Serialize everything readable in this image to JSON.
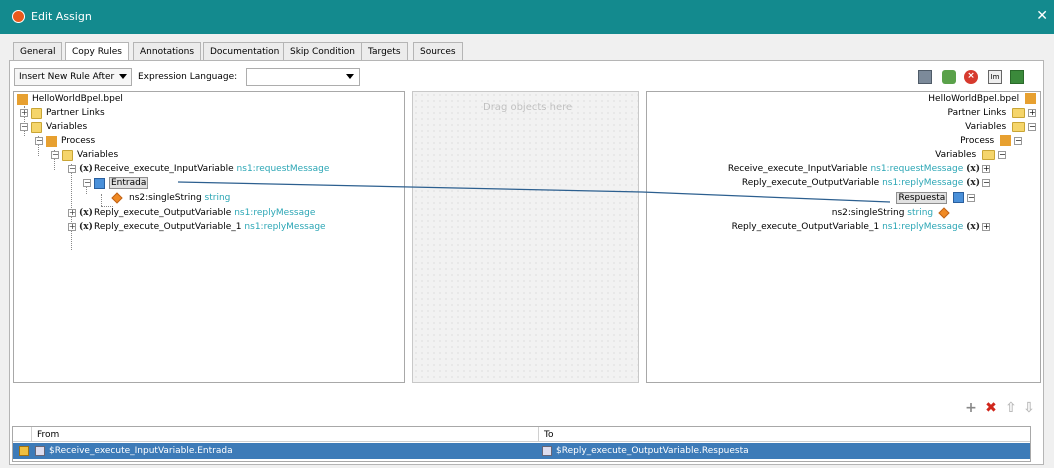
{
  "window": {
    "title": "Edit Assign",
    "close_glyph": "✕"
  },
  "tabs": [
    {
      "label": "General"
    },
    {
      "label": "Copy Rules",
      "active": true
    },
    {
      "label": "Annotations"
    },
    {
      "label": "Documentation"
    },
    {
      "label": "Skip Condition"
    },
    {
      "label": "Targets"
    },
    {
      "label": "Sources"
    }
  ],
  "toolbar": {
    "insert_rule_label": "Insert New Rule After",
    "expression_language_label": "Expression Language:",
    "expression_language_value": "",
    "icons": [
      "function-icon",
      "xpath-icon",
      "delete-icon",
      "literal-icon",
      "append-icon"
    ]
  },
  "center": {
    "placeholder": "Drag objects here"
  },
  "source_tree": {
    "root": "HelloWorldBpel.bpel",
    "partner_links": "Partner Links",
    "variables": "Variables",
    "process": "Process",
    "process_variables": "Variables",
    "receive_var": "Receive_execute_InputVariable",
    "receive_type": "ns1:requestMessage",
    "part": "Entrada",
    "part_child": "ns2:singleString",
    "part_child_type": "string",
    "reply_var": "Reply_execute_OutputVariable",
    "reply_type": "ns1:replyMessage",
    "reply_var_1": "Reply_execute_OutputVariable_1",
    "reply_type_1": "ns1:replyMessage"
  },
  "target_tree": {
    "root": "HelloWorldBpel.bpel",
    "partner_links": "Partner Links",
    "variables": "Variables",
    "process": "Process",
    "process_variables": "Variables",
    "receive_var": "Receive_execute_InputVariable",
    "receive_type": "ns1:requestMessage",
    "reply_var": "Reply_execute_OutputVariable",
    "reply_type": "ns1:replyMessage",
    "part": "Respuesta",
    "part_child": "ns2:singleString",
    "part_child_type": "string",
    "reply_var_1": "Reply_execute_OutputVariable_1",
    "reply_type_1": "ns1:replyMessage"
  },
  "rules_table": {
    "columns": [
      "From",
      "To"
    ],
    "rows": [
      {
        "from": "$Receive_execute_InputVariable.Entrada",
        "to": "$Reply_execute_OutputVariable.Respuesta"
      }
    ]
  },
  "colors": {
    "titlebar": "#138a8e",
    "selection": "#3d7bb8",
    "type_text": "#2ba6b5",
    "mapping_line": "#2c5f8f"
  }
}
